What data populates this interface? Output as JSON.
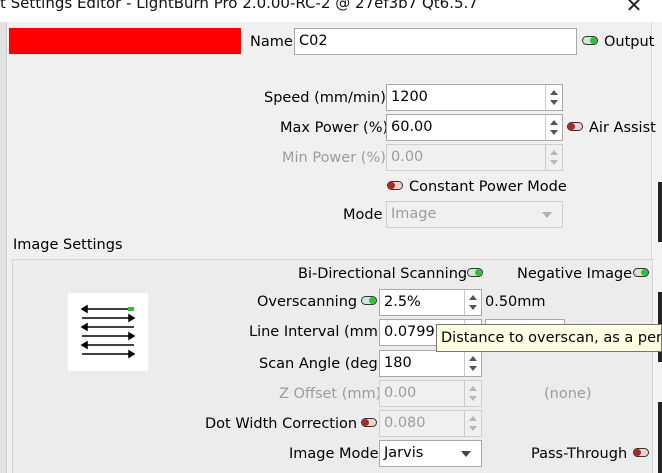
{
  "window": {
    "title": "t Settings Editor - LightBurn Pro 2.0.00-RC-2 @ 27ef3b7 Qt6.5.7",
    "close_label": "✕"
  },
  "layer": {
    "color": "#ff0000",
    "name_label": "Name",
    "name_value": "C02",
    "output_label": "Output"
  },
  "speed": {
    "label": "Speed (mm/min)",
    "value": "1200"
  },
  "max_power": {
    "label": "Max Power (%)",
    "value": "60.00"
  },
  "air_assist": {
    "label": "Air Assist"
  },
  "min_power": {
    "label": "Min Power (%)",
    "value": "0.00"
  },
  "constant_power": {
    "label": "Constant Power Mode"
  },
  "mode": {
    "label": "Mode",
    "value": "Image"
  },
  "image_settings": {
    "heading": "Image Settings",
    "bidirectional_label": "Bi-Directional Scanning",
    "negative_image_label": "Negative Image",
    "overscanning_label": "Overscanning",
    "overscanning_value": "2.5%",
    "overscanning_mm": "0.50mm",
    "line_interval_label": "Line Interval (mm)",
    "line_interval_value": "0.0799",
    "scan_angle_label": "Scan Angle (deg)",
    "scan_angle_value": "180",
    "z_offset_label": "Z Offset (mm)",
    "z_offset_value": "0.00",
    "z_offset_note": "(none)",
    "dot_width_label": "Dot Width Correction",
    "dot_width_value": "0.080",
    "image_mode_label": "Image Mode",
    "image_mode_value": "Jarvis",
    "pass_through_label": "Pass-Through"
  },
  "tooltip": {
    "text": "Distance to overscan, as a percen"
  },
  "colors": {
    "toggle_on": "#2fbf3a",
    "toggle_off": "#b3261e",
    "tooltip_bg": "#ffffe1"
  }
}
